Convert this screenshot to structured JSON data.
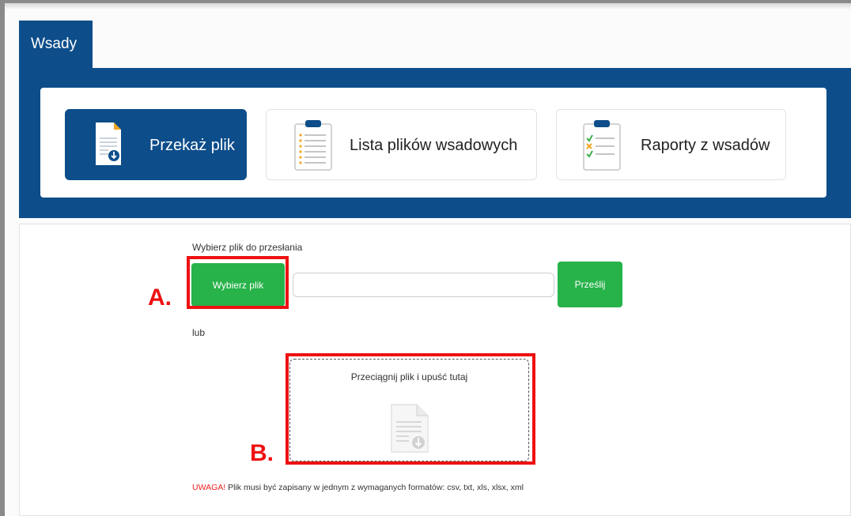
{
  "tab": {
    "label": "Wsady"
  },
  "nav": {
    "items": [
      {
        "label": "Przekaż plik",
        "icon": "upload-document-icon",
        "active": true
      },
      {
        "label": "Lista plików wsadowych",
        "icon": "clipboard-list-icon",
        "active": false
      },
      {
        "label": "Raporty z wsadów",
        "icon": "clipboard-check-icon",
        "active": false
      }
    ]
  },
  "upload": {
    "prompt": "Wybierz plik do przesłania",
    "choose_label": "Wybierz plik",
    "file_value": "",
    "submit_label": "Prześlij",
    "or_label": "lub",
    "dropzone_text": "Przeciągnij plik i upuść tutaj",
    "dropzone_icon": "download-document-icon"
  },
  "annotations": {
    "a": "A.",
    "b": "B."
  },
  "warning": {
    "prefix": "UWAGA!",
    "text": " Plik musi być zapisany w jednym z wymaganych formatów: csv, txt, xls, xlsx, xml"
  },
  "colors": {
    "primary": "#0d4d8a",
    "success": "#27b24a",
    "highlight": "#ee1111"
  }
}
